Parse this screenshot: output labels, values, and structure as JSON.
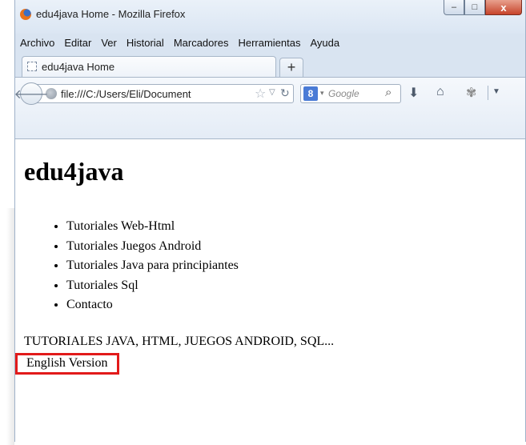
{
  "window": {
    "title": "edu4java Home - Mozilla Firefox",
    "controls": {
      "minimize": "–",
      "maximize": "□",
      "close": "x"
    }
  },
  "menubar": [
    "Archivo",
    "Editar",
    "Ver",
    "Historial",
    "Marcadores",
    "Herramientas",
    "Ayuda"
  ],
  "tabs": [
    {
      "label": "edu4java Home"
    }
  ],
  "newtab_label": "+",
  "navbar": {
    "url": "file:///C:/Users/Eli/Document",
    "search": {
      "engine_icon": "8",
      "placeholder": "Google"
    }
  },
  "icons": {
    "back": "back-arrow-icon",
    "bookmark": "star-icon",
    "reload": "reload-icon",
    "download": "download-arrow-icon",
    "home": "home-icon",
    "addon": "puzzle-icon"
  },
  "page": {
    "heading": "edu4java",
    "links": [
      "Tutoriales Web-Html",
      "Tutoriales Juegos Android",
      "Tutoriales Java para principiantes",
      "Tutoriales Sql",
      "Contacto"
    ],
    "subtitle": "TUTORIALES JAVA, HTML, JUEGOS ANDROID, SQL...",
    "english_link": "English Version"
  },
  "colors": {
    "highlight_border": "#e21a1a",
    "firefox_frame": "#d9e4f1"
  }
}
